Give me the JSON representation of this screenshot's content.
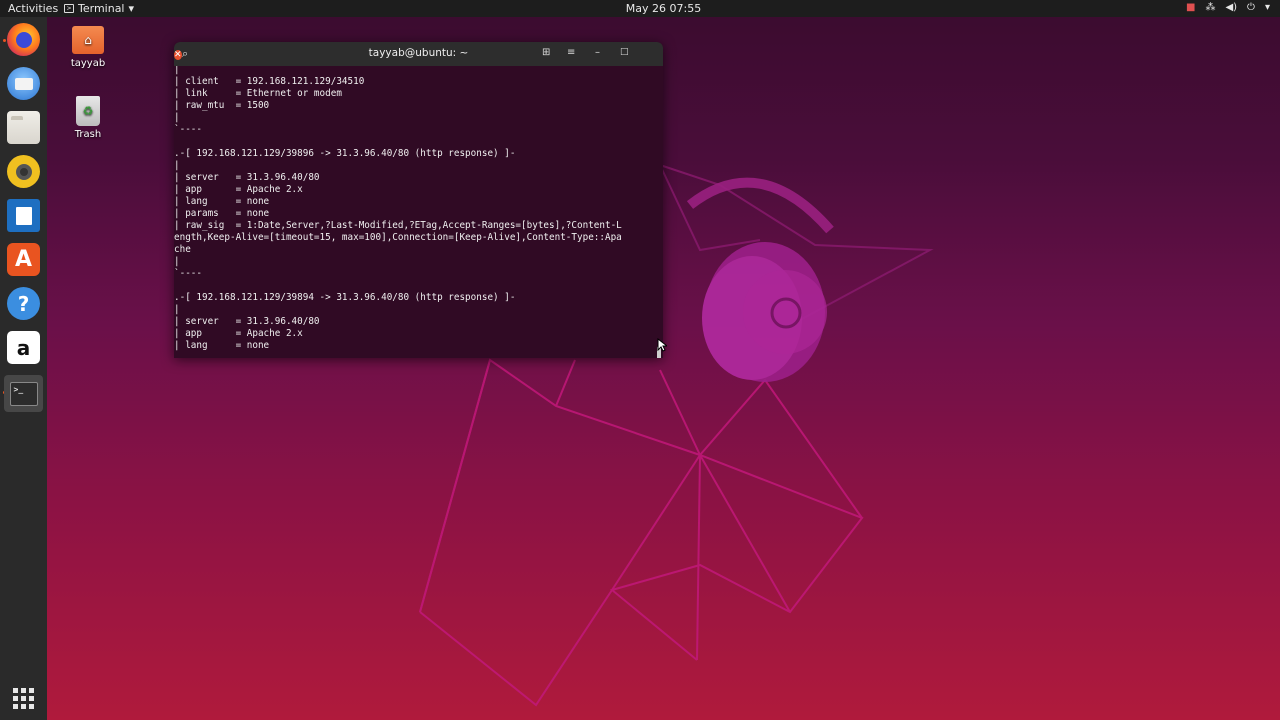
{
  "topbar": {
    "activities": "Activities",
    "app_name": "Terminal",
    "clock": "May 26  07:55"
  },
  "dock": {
    "items": [
      "firefox",
      "thunderbird",
      "files",
      "rhythmbox",
      "libreoffice-writer",
      "ubuntu-software",
      "help",
      "amazon",
      "terminal",
      "show-applications"
    ]
  },
  "desktop": {
    "home_label": "tayyab",
    "trash_label": "Trash"
  },
  "terminal": {
    "title": "tayyab@ubuntu: ~",
    "lines": [
      "|",
      "| client   = 192.168.121.129/34510",
      "| link     = Ethernet or modem",
      "| raw_mtu  = 1500",
      "|",
      "`----",
      "",
      ".-[ 192.168.121.129/39896 -> 31.3.96.40/80 (http response) ]-",
      "|",
      "| server   = 31.3.96.40/80",
      "| app      = Apache 2.x",
      "| lang     = none",
      "| params   = none",
      "| raw_sig  = 1:Date,Server,?Last-Modified,?ETag,Accept-Ranges=[bytes],?Content-L",
      "ength,Keep-Alive=[timeout=15, max=100],Connection=[Keep-Alive],Content-Type::Apa",
      "che",
      "|",
      "`----",
      "",
      ".-[ 192.168.121.129/39894 -> 31.3.96.40/80 (http response) ]-",
      "|",
      "| server   = 31.3.96.40/80",
      "| app      = Apache 2.x",
      "| lang     = none"
    ]
  },
  "colors": {
    "terminal_bg": "#300a24",
    "accent": "#e95420",
    "close_button": "#e9502f"
  }
}
